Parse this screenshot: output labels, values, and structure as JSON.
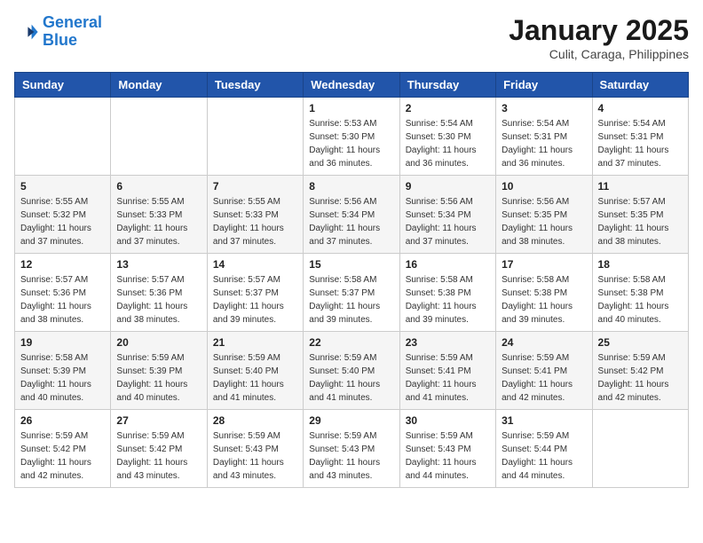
{
  "logo": {
    "line1": "General",
    "line2": "Blue"
  },
  "title": "January 2025",
  "subtitle": "Culit, Caraga, Philippines",
  "days_of_week": [
    "Sunday",
    "Monday",
    "Tuesday",
    "Wednesday",
    "Thursday",
    "Friday",
    "Saturday"
  ],
  "weeks": [
    [
      {
        "day": "",
        "info": ""
      },
      {
        "day": "",
        "info": ""
      },
      {
        "day": "",
        "info": ""
      },
      {
        "day": "1",
        "info": "Sunrise: 5:53 AM\nSunset: 5:30 PM\nDaylight: 11 hours and 36 minutes."
      },
      {
        "day": "2",
        "info": "Sunrise: 5:54 AM\nSunset: 5:30 PM\nDaylight: 11 hours and 36 minutes."
      },
      {
        "day": "3",
        "info": "Sunrise: 5:54 AM\nSunset: 5:31 PM\nDaylight: 11 hours and 36 minutes."
      },
      {
        "day": "4",
        "info": "Sunrise: 5:54 AM\nSunset: 5:31 PM\nDaylight: 11 hours and 37 minutes."
      }
    ],
    [
      {
        "day": "5",
        "info": "Sunrise: 5:55 AM\nSunset: 5:32 PM\nDaylight: 11 hours and 37 minutes."
      },
      {
        "day": "6",
        "info": "Sunrise: 5:55 AM\nSunset: 5:33 PM\nDaylight: 11 hours and 37 minutes."
      },
      {
        "day": "7",
        "info": "Sunrise: 5:55 AM\nSunset: 5:33 PM\nDaylight: 11 hours and 37 minutes."
      },
      {
        "day": "8",
        "info": "Sunrise: 5:56 AM\nSunset: 5:34 PM\nDaylight: 11 hours and 37 minutes."
      },
      {
        "day": "9",
        "info": "Sunrise: 5:56 AM\nSunset: 5:34 PM\nDaylight: 11 hours and 37 minutes."
      },
      {
        "day": "10",
        "info": "Sunrise: 5:56 AM\nSunset: 5:35 PM\nDaylight: 11 hours and 38 minutes."
      },
      {
        "day": "11",
        "info": "Sunrise: 5:57 AM\nSunset: 5:35 PM\nDaylight: 11 hours and 38 minutes."
      }
    ],
    [
      {
        "day": "12",
        "info": "Sunrise: 5:57 AM\nSunset: 5:36 PM\nDaylight: 11 hours and 38 minutes."
      },
      {
        "day": "13",
        "info": "Sunrise: 5:57 AM\nSunset: 5:36 PM\nDaylight: 11 hours and 38 minutes."
      },
      {
        "day": "14",
        "info": "Sunrise: 5:57 AM\nSunset: 5:37 PM\nDaylight: 11 hours and 39 minutes."
      },
      {
        "day": "15",
        "info": "Sunrise: 5:58 AM\nSunset: 5:37 PM\nDaylight: 11 hours and 39 minutes."
      },
      {
        "day": "16",
        "info": "Sunrise: 5:58 AM\nSunset: 5:38 PM\nDaylight: 11 hours and 39 minutes."
      },
      {
        "day": "17",
        "info": "Sunrise: 5:58 AM\nSunset: 5:38 PM\nDaylight: 11 hours and 39 minutes."
      },
      {
        "day": "18",
        "info": "Sunrise: 5:58 AM\nSunset: 5:38 PM\nDaylight: 11 hours and 40 minutes."
      }
    ],
    [
      {
        "day": "19",
        "info": "Sunrise: 5:58 AM\nSunset: 5:39 PM\nDaylight: 11 hours and 40 minutes."
      },
      {
        "day": "20",
        "info": "Sunrise: 5:59 AM\nSunset: 5:39 PM\nDaylight: 11 hours and 40 minutes."
      },
      {
        "day": "21",
        "info": "Sunrise: 5:59 AM\nSunset: 5:40 PM\nDaylight: 11 hours and 41 minutes."
      },
      {
        "day": "22",
        "info": "Sunrise: 5:59 AM\nSunset: 5:40 PM\nDaylight: 11 hours and 41 minutes."
      },
      {
        "day": "23",
        "info": "Sunrise: 5:59 AM\nSunset: 5:41 PM\nDaylight: 11 hours and 41 minutes."
      },
      {
        "day": "24",
        "info": "Sunrise: 5:59 AM\nSunset: 5:41 PM\nDaylight: 11 hours and 42 minutes."
      },
      {
        "day": "25",
        "info": "Sunrise: 5:59 AM\nSunset: 5:42 PM\nDaylight: 11 hours and 42 minutes."
      }
    ],
    [
      {
        "day": "26",
        "info": "Sunrise: 5:59 AM\nSunset: 5:42 PM\nDaylight: 11 hours and 42 minutes."
      },
      {
        "day": "27",
        "info": "Sunrise: 5:59 AM\nSunset: 5:42 PM\nDaylight: 11 hours and 43 minutes."
      },
      {
        "day": "28",
        "info": "Sunrise: 5:59 AM\nSunset: 5:43 PM\nDaylight: 11 hours and 43 minutes."
      },
      {
        "day": "29",
        "info": "Sunrise: 5:59 AM\nSunset: 5:43 PM\nDaylight: 11 hours and 43 minutes."
      },
      {
        "day": "30",
        "info": "Sunrise: 5:59 AM\nSunset: 5:43 PM\nDaylight: 11 hours and 44 minutes."
      },
      {
        "day": "31",
        "info": "Sunrise: 5:59 AM\nSunset: 5:44 PM\nDaylight: 11 hours and 44 minutes."
      },
      {
        "day": "",
        "info": ""
      }
    ]
  ]
}
